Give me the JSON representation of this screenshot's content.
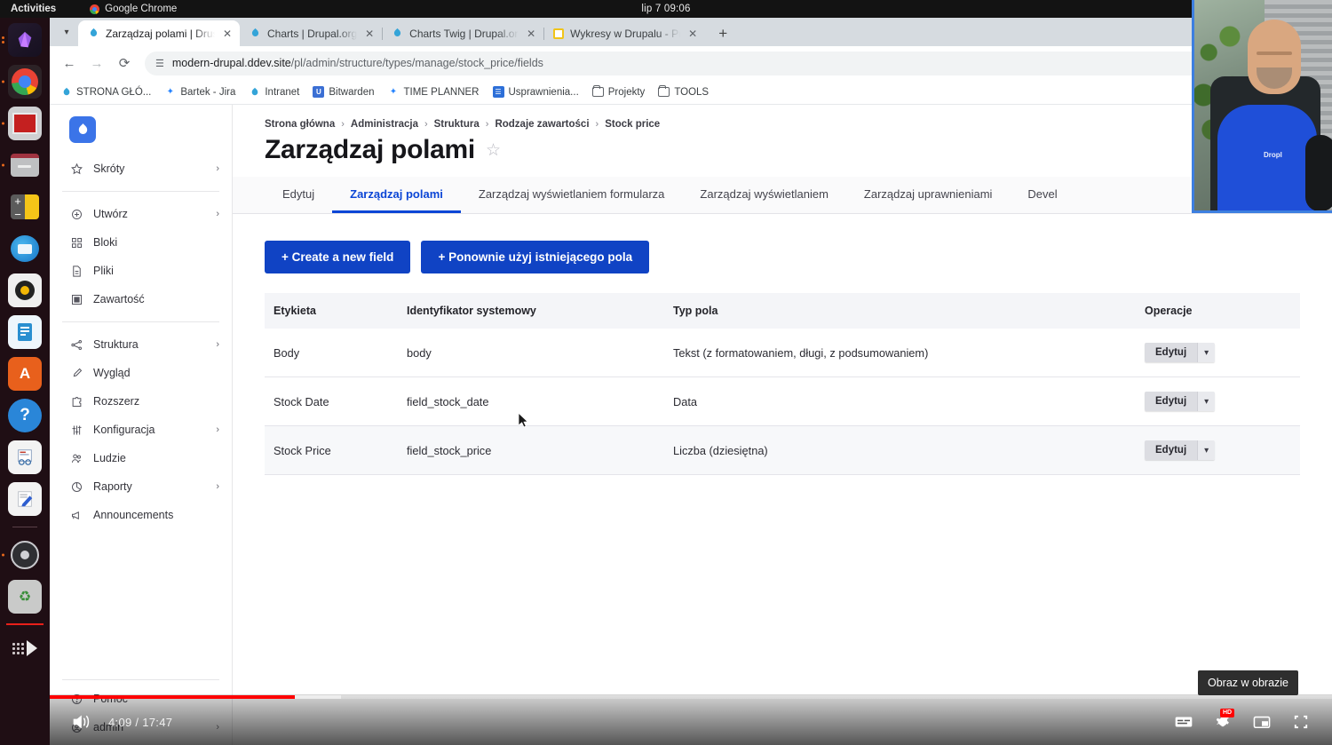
{
  "os": {
    "activities": "Activities",
    "app_name": "Google Chrome",
    "clock": "lip 7  09:06",
    "bell_icon": "bell-icon"
  },
  "dock": {
    "items": [
      {
        "name": "amethyst-app",
        "running": true
      },
      {
        "name": "google-chrome",
        "running": true
      },
      {
        "name": "remote-desktop",
        "running": true
      },
      {
        "name": "files",
        "running": true
      },
      {
        "name": "calculator",
        "running": false
      },
      {
        "name": "thunderbird",
        "running": false
      },
      {
        "name": "rhythmbox",
        "running": false
      },
      {
        "name": "libreoffice-writer",
        "running": false
      },
      {
        "name": "ubuntu-software",
        "running": false
      },
      {
        "name": "help",
        "running": false
      },
      {
        "name": "document-viewer",
        "running": false
      },
      {
        "name": "text-editor",
        "running": false
      },
      {
        "name": "obs-studio",
        "running": true
      },
      {
        "name": "trash",
        "running": false
      }
    ]
  },
  "browser": {
    "tabs": [
      {
        "title": "Zarządzaj polami | Drush",
        "favicon": "drupal-icon",
        "active": true
      },
      {
        "title": "Charts | Drupal.org",
        "favicon": "drupal-icon",
        "active": false
      },
      {
        "title": "Charts Twig | Drupal.org",
        "favicon": "drupal-icon",
        "active": false
      },
      {
        "title": "Wykresy w Drupalu - Pre",
        "favicon": "youtube-icon",
        "active": false
      }
    ],
    "new_tab_label": "+",
    "url_host": "modern-drupal.ddev.site",
    "url_path": "/pl/admin/structure/types/manage/stock_price/fields",
    "bookmarks": [
      {
        "label": "STRONA GŁÓ...",
        "icon": "drupal-icon"
      },
      {
        "label": "Bartek - Jira",
        "icon": "jira-icon"
      },
      {
        "label": "Intranet",
        "icon": "drupal-icon"
      },
      {
        "label": "Bitwarden",
        "icon": "bitwarden-icon"
      },
      {
        "label": "TIME PLANNER",
        "icon": "jira-icon"
      },
      {
        "label": "Usprawnienia...",
        "icon": "confluence-icon"
      },
      {
        "label": "Projekty",
        "icon": "folder-icon"
      },
      {
        "label": "TOOLS",
        "icon": "folder-icon"
      }
    ]
  },
  "sidebar": {
    "logo": "drupal-logo",
    "groups": [
      {
        "items": [
          {
            "label": "Skróty",
            "icon": "star-icon",
            "chevron": true
          }
        ]
      },
      {
        "items": [
          {
            "label": "Utwórz",
            "icon": "plus-circle-icon",
            "chevron": true
          },
          {
            "label": "Bloki",
            "icon": "blocks-icon",
            "chevron": false
          },
          {
            "label": "Pliki",
            "icon": "file-icon",
            "chevron": false
          },
          {
            "label": "Zawartość",
            "icon": "content-icon",
            "chevron": false
          }
        ]
      },
      {
        "items": [
          {
            "label": "Struktura",
            "icon": "structure-icon",
            "chevron": true
          },
          {
            "label": "Wygląd",
            "icon": "brush-icon",
            "chevron": false
          },
          {
            "label": "Rozszerz",
            "icon": "puzzle-icon",
            "chevron": false
          },
          {
            "label": "Konfiguracja",
            "icon": "sliders-icon",
            "chevron": true
          },
          {
            "label": "Ludzie",
            "icon": "people-icon",
            "chevron": false
          },
          {
            "label": "Raporty",
            "icon": "chart-pie-icon",
            "chevron": true
          },
          {
            "label": "Announcements",
            "icon": "megaphone-icon",
            "chevron": false
          }
        ]
      }
    ],
    "bottom": [
      {
        "label": "Pomoc",
        "icon": "question-circle-icon",
        "chevron": false
      },
      {
        "label": "admin",
        "icon": "user-circle-icon",
        "chevron": true
      }
    ]
  },
  "page": {
    "breadcrumb": [
      "Strona główna",
      "Administracja",
      "Struktura",
      "Rodzaje zawartości",
      "Stock price"
    ],
    "breadcrumb_sep": "›",
    "title": "Zarządzaj polami",
    "star_icon": "star-outline-icon",
    "tabs": [
      {
        "label": "Edytuj",
        "active": false
      },
      {
        "label": "Zarządzaj polami",
        "active": true
      },
      {
        "label": "Zarządzaj wyświetlaniem formularza",
        "active": false
      },
      {
        "label": "Zarządzaj wyświetlaniem",
        "active": false
      },
      {
        "label": "Zarządzaj uprawnieniami",
        "active": false
      },
      {
        "label": "Devel",
        "active": false
      }
    ],
    "buttons": [
      {
        "label": "+ Create a new field",
        "name": "create-new-field-button"
      },
      {
        "label": "+ Ponownie użyj istniejącego pola",
        "name": "reuse-existing-field-button"
      }
    ],
    "table": {
      "headers": [
        "Etykieta",
        "Identyfikator systemowy",
        "Typ pola",
        "Operacje"
      ],
      "rows": [
        {
          "label": "Body",
          "machine_name": "body",
          "field_type": "Tekst (z formatowaniem, długi, z podsumowaniem)",
          "op_label": "Edytuj"
        },
        {
          "label": "Stock Date",
          "machine_name": "field_stock_date",
          "field_type": "Data",
          "op_label": "Edytuj"
        },
        {
          "label": "Stock Price",
          "machine_name": "field_stock_price",
          "field_type": "Liczba (dziesiętna)",
          "op_label": "Edytuj"
        }
      ]
    }
  },
  "player": {
    "current_time": "4:09",
    "separator": "/",
    "duration": "17:47",
    "time_display": "4:09 / 17:47",
    "played_percent": 19.1,
    "loaded_percent": 22.7,
    "tooltip": "Obraz w obrazie",
    "hd_badge": "HD",
    "controls": {
      "volume": "volume-icon",
      "subtitles": "subtitles-icon",
      "settings": "settings-gear-icon",
      "miniplayer": "miniplayer-icon",
      "fullscreen": "fullscreen-icon"
    },
    "progress_color": "#ff0000"
  },
  "colors": {
    "drupal_blue": "#1043c4",
    "tab_active": "#0c46d6",
    "progress_red": "#ff0000"
  }
}
